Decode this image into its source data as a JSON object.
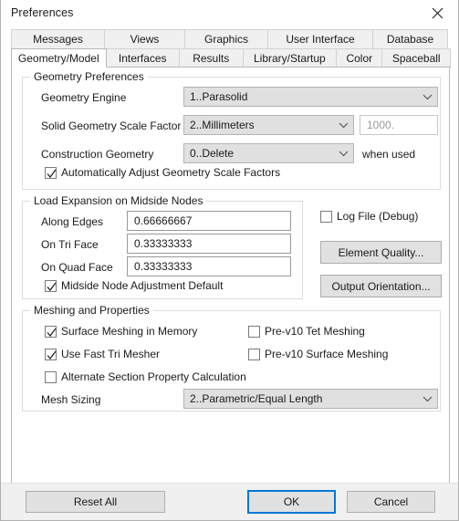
{
  "window": {
    "title": "Preferences",
    "close_icon": "close-icon"
  },
  "tabs": {
    "row1": [
      {
        "label": "Messages",
        "active": false
      },
      {
        "label": "Views",
        "active": false
      },
      {
        "label": "Graphics",
        "active": false
      },
      {
        "label": "User Interface",
        "active": false
      },
      {
        "label": "Database",
        "active": false
      }
    ],
    "row2": [
      {
        "label": "Geometry/Model",
        "active": true
      },
      {
        "label": "Interfaces",
        "active": false
      },
      {
        "label": "Results",
        "active": false
      },
      {
        "label": "Library/Startup",
        "active": false
      },
      {
        "label": "Color",
        "active": false
      },
      {
        "label": "Spaceball",
        "active": false
      }
    ]
  },
  "geometry_preferences": {
    "title": "Geometry Preferences",
    "geometry_engine": {
      "label": "Geometry Engine",
      "value": "1..Parasolid"
    },
    "solid_scale_factor": {
      "label": "Solid Geometry Scale Factor",
      "value": "2..Millimeters",
      "numeric_value": "1000."
    },
    "construction_geometry": {
      "label": "Construction Geometry",
      "value": "0..Delete",
      "suffix": "when used"
    },
    "auto_adjust": {
      "label": "Automatically Adjust Geometry Scale Factors",
      "checked": true
    }
  },
  "load_expansion": {
    "title": "Load Expansion on Midside Nodes",
    "along_edges": {
      "label": "Along Edges",
      "value": "0.66666667"
    },
    "on_tri_face": {
      "label": "On Tri Face",
      "value": "0.33333333"
    },
    "on_quad_face": {
      "label": "On Quad Face",
      "value": "0.33333333"
    },
    "midside_default": {
      "label": "Midside Node Adjustment Default",
      "checked": true
    }
  },
  "side_options": {
    "log_file": {
      "label": "Log File (Debug)",
      "checked": false
    },
    "element_quality_button": "Element Quality...",
    "output_orientation_button": "Output Orientation..."
  },
  "meshing": {
    "title": "Meshing and Properties",
    "surface_meshing_memory": {
      "label": "Surface Meshing in Memory",
      "checked": true
    },
    "use_fast_tri_mesher": {
      "label": "Use Fast Tri Mesher",
      "checked": true
    },
    "alternate_section": {
      "label": "Alternate Section Property Calculation",
      "checked": false
    },
    "pre_v10_tet": {
      "label": "Pre-v10 Tet Meshing",
      "checked": false
    },
    "pre_v10_surface": {
      "label": "Pre-v10 Surface Meshing",
      "checked": false
    },
    "mesh_sizing": {
      "label": "Mesh Sizing",
      "value": "2..Parametric/Equal Length"
    }
  },
  "footer": {
    "reset_all": "Reset All",
    "ok": "OK",
    "cancel": "Cancel"
  },
  "colors": {
    "accent": "#0078d7",
    "combo_bg": "#e0e0e0",
    "button_bg": "#e1e1e1",
    "footer_bg": "#f0f0f0",
    "tab_bg": "#f0f0f0"
  }
}
